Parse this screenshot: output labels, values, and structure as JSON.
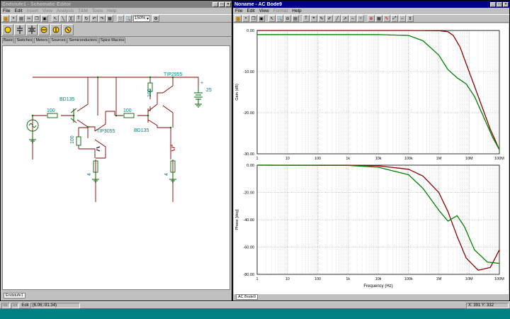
{
  "schematic": {
    "title": "Endstufe1 - Schematic Editor",
    "menu": [
      "File",
      "Edit",
      "Insert",
      "View",
      "Analysis",
      "T&M",
      "Tools",
      "Help"
    ],
    "disabled_menu": [
      "Insert",
      "View",
      "Analysis",
      "T&M",
      "Tools",
      "Help"
    ],
    "zoom": "150%",
    "tabs": [
      "Basic",
      "Switches",
      "Meters",
      "Sources",
      "Semiconductors",
      "Spice Macros"
    ],
    "bottom_tab": "Endstufe1",
    "labels": {
      "r1": "100",
      "r2": "100",
      "r3": "100",
      "r4": "100",
      "q1": "BD135",
      "q2": "TIP3055",
      "q3": "BD135",
      "q4": "TIP2955",
      "v": "25",
      "rl1": "4",
      "rl2": "4",
      "plus": "+"
    }
  },
  "bode": {
    "title": "Noname - AC Bode9",
    "menu": [
      "File",
      "Edit",
      "View",
      "Format",
      "Help"
    ],
    "disabled_menu": [
      "Format"
    ],
    "bottom_tab": "AC Bode9",
    "colors": {
      "series1": "#8b0000",
      "series2": "#008000"
    }
  },
  "chart_data": [
    {
      "type": "line",
      "title": "",
      "xlabel": "Frequency (Hz)",
      "ylabel": "Gain (dB)",
      "xscale": "log",
      "xlim": [
        1,
        100000000
      ],
      "ylim": [
        -30,
        0
      ],
      "xticks": [
        "1",
        "10",
        "100",
        "1k",
        "10k",
        "100k",
        "1M",
        "10M",
        "100M"
      ],
      "yticks": [
        "0.00",
        "-10.00",
        "-20.00",
        "-30.00"
      ],
      "series": [
        {
          "x": [
            1,
            100,
            10000,
            100000,
            1000000,
            2000000,
            3000000,
            5000000,
            10000000,
            20000000,
            50000000,
            100000000
          ],
          "y": [
            0,
            0,
            0,
            0,
            -0.05,
            -0.3,
            -1.2,
            -4,
            -10,
            -16,
            -24,
            -29
          ]
        },
        {
          "x": [
            1,
            100,
            10000,
            100000,
            300000,
            1000000,
            2000000,
            4000000,
            8000000,
            15000000,
            30000000,
            60000000,
            100000000
          ],
          "y": [
            -1,
            -1,
            -1,
            -1.2,
            -2.5,
            -6,
            -9.5,
            -11.5,
            -13,
            -16,
            -21,
            -26,
            -29
          ]
        }
      ]
    },
    {
      "type": "line",
      "title": "",
      "xlabel": "Frequency (Hz)",
      "ylabel": "Phase [deg]",
      "xscale": "log",
      "xlim": [
        1,
        100000000
      ],
      "ylim": [
        -80,
        0
      ],
      "xticks": [
        "1",
        "10",
        "100",
        "1k",
        "10k",
        "100k",
        "1M",
        "10M",
        "100M"
      ],
      "yticks": [
        "0.00",
        "-20.00",
        "-40.00",
        "-60.00",
        "-80.00"
      ],
      "series": [
        {
          "x": [
            1,
            1000,
            10000,
            100000,
            300000,
            1000000,
            2000000,
            4000000,
            8000000,
            20000000,
            50000000,
            100000000
          ],
          "y": [
            0,
            0,
            -0.5,
            -3,
            -8,
            -20,
            -34,
            -52,
            -68,
            -77,
            -75,
            -62
          ]
        },
        {
          "x": [
            1,
            1000,
            10000,
            100000,
            300000,
            1000000,
            2000000,
            4000000,
            7000000,
            15000000,
            40000000,
            100000000
          ],
          "y": [
            0,
            -0.2,
            -1.5,
            -7,
            -17,
            -33,
            -41,
            -37,
            -45,
            -62,
            -71,
            -72
          ]
        }
      ]
    }
  ],
  "status": {
    "mode": "Edit",
    "coords": "(6.06;-91.34)",
    "cursor": "X: 391  Y: 332"
  }
}
